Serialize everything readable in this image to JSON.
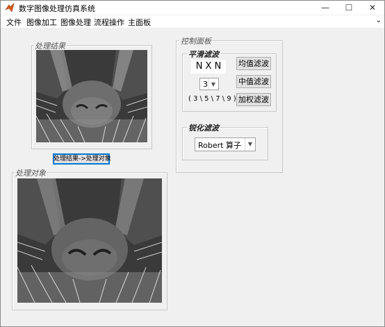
{
  "window": {
    "title": "数字图像处理仿真系统"
  },
  "menu": [
    "文件",
    "图像加工",
    "图像处理",
    "流程操作",
    "主面板"
  ],
  "result_panel": {
    "legend": "处理结果",
    "image_desc": "filtered-image"
  },
  "swap_button": {
    "label": "处理结果->处理对象"
  },
  "object_panel": {
    "legend": "处理对象",
    "image_desc": "source-image"
  },
  "control_panel": {
    "legend": "控制面板",
    "smooth": {
      "legend": "平滑滤波",
      "nxn_label": "N X N",
      "size_select": "3",
      "size_hint": "( 3 \\ 5 \\ 7 \\ 9 )",
      "mean_button": "均值滤波",
      "median_button": "中值滤波",
      "weighted_button": "加权滤波"
    },
    "sharpen": {
      "legend": "锐化滤波",
      "operator_select": "Robert 算子"
    }
  },
  "colors": {
    "frame_border": "#c8c8c8",
    "focus": "#0078d7",
    "bg": "#f0f0f0"
  }
}
